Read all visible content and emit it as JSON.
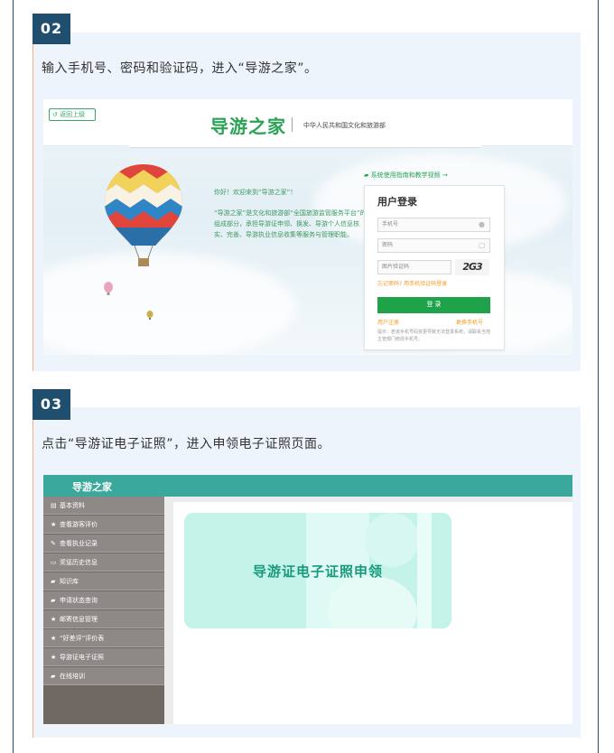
{
  "step1": {
    "number": "02",
    "text": "输入手机号、密码和验证码，进入“导游之家”。",
    "screenshot": {
      "back_button": "返回上级",
      "brand": "导游之家",
      "brand_sub": "中华人民共和国文化和旅游部",
      "welcome": "你好！欢迎来到“导游之家”！",
      "intro": "“导游之家”是文化和旅游部“全国旅游监管服务平台”的组成部分，承担导游证申领、换发、导游个人信息核实、完善、导游执业信息收集等服务与管理职能。",
      "guide_link": "系统使用指南和教学视频 →",
      "login": {
        "title": "用户登录",
        "phone_placeholder": "手机号",
        "password_placeholder": "密码",
        "code_placeholder": "图片验证码",
        "captcha": "2G3",
        "forgot": "忘记密码? 用手机验证码登录",
        "button": "登 录",
        "register": "用户注册",
        "change_phone": "更换手机号",
        "hint": "提示：若该手机号码变更导致无法登录系统，请联系当地主管部门修改手机号。"
      }
    }
  },
  "step2": {
    "number": "03",
    "text": "点击“导游证电子证照”，进入申领电子证照页面。",
    "screenshot": {
      "app_name": "导游之家",
      "sidebar": [
        {
          "icon": "doc-icon",
          "glyph": "▤",
          "label": "基本资料"
        },
        {
          "icon": "star-icon",
          "glyph": "★",
          "label": "查看游客评价"
        },
        {
          "icon": "edit-icon",
          "glyph": "✎",
          "label": "查看执业记录"
        },
        {
          "icon": "card-icon",
          "glyph": "▭",
          "label": "奖惩历史信息"
        },
        {
          "icon": "book-icon",
          "glyph": "▰",
          "label": "知识库"
        },
        {
          "icon": "book-icon",
          "glyph": "▰",
          "label": "申请状态查询"
        },
        {
          "icon": "star-icon",
          "glyph": "★",
          "label": "邮寄信息管理"
        },
        {
          "icon": "star-icon",
          "glyph": "★",
          "label": "“好差评”评价表"
        },
        {
          "icon": "star-icon",
          "glyph": "★",
          "label": "导游证电子证照"
        },
        {
          "icon": "book-icon",
          "glyph": "▰",
          "label": "在线培训"
        }
      ],
      "card_label": "导游证电子证照申领"
    }
  },
  "colors": {
    "frame": "#1f4e6e",
    "section_bg": "#eef4fb",
    "brand_green": "#2ba255",
    "header_teal": "#3aa89a",
    "card_teal": "#c4f3e9"
  }
}
